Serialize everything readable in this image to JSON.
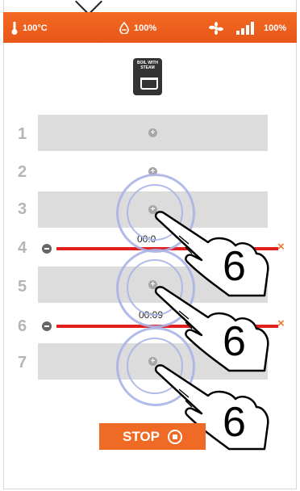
{
  "status": {
    "temperature": "100°C",
    "humidity": "100%",
    "fan": "100%",
    "icons": [
      "thermometer-icon",
      "droplet-icon",
      "fan-icon",
      "signal-bars-icon"
    ]
  },
  "mode": {
    "label": "BOIL WITH STEAM",
    "icon": "pot-icon"
  },
  "rows": [
    {
      "num": "1"
    },
    {
      "num": "2"
    },
    {
      "num": "3"
    },
    {
      "num": "4",
      "timer": "00:0"
    },
    {
      "num": "5"
    },
    {
      "num": "6",
      "timer": "00:09"
    },
    {
      "num": "7"
    }
  ],
  "stop": {
    "label": "STOP"
  },
  "annotations": {
    "step": "6"
  },
  "colors": {
    "accent": "#f26a21",
    "timer_line": "#e41f1f",
    "slot": "#dcdcdc"
  }
}
